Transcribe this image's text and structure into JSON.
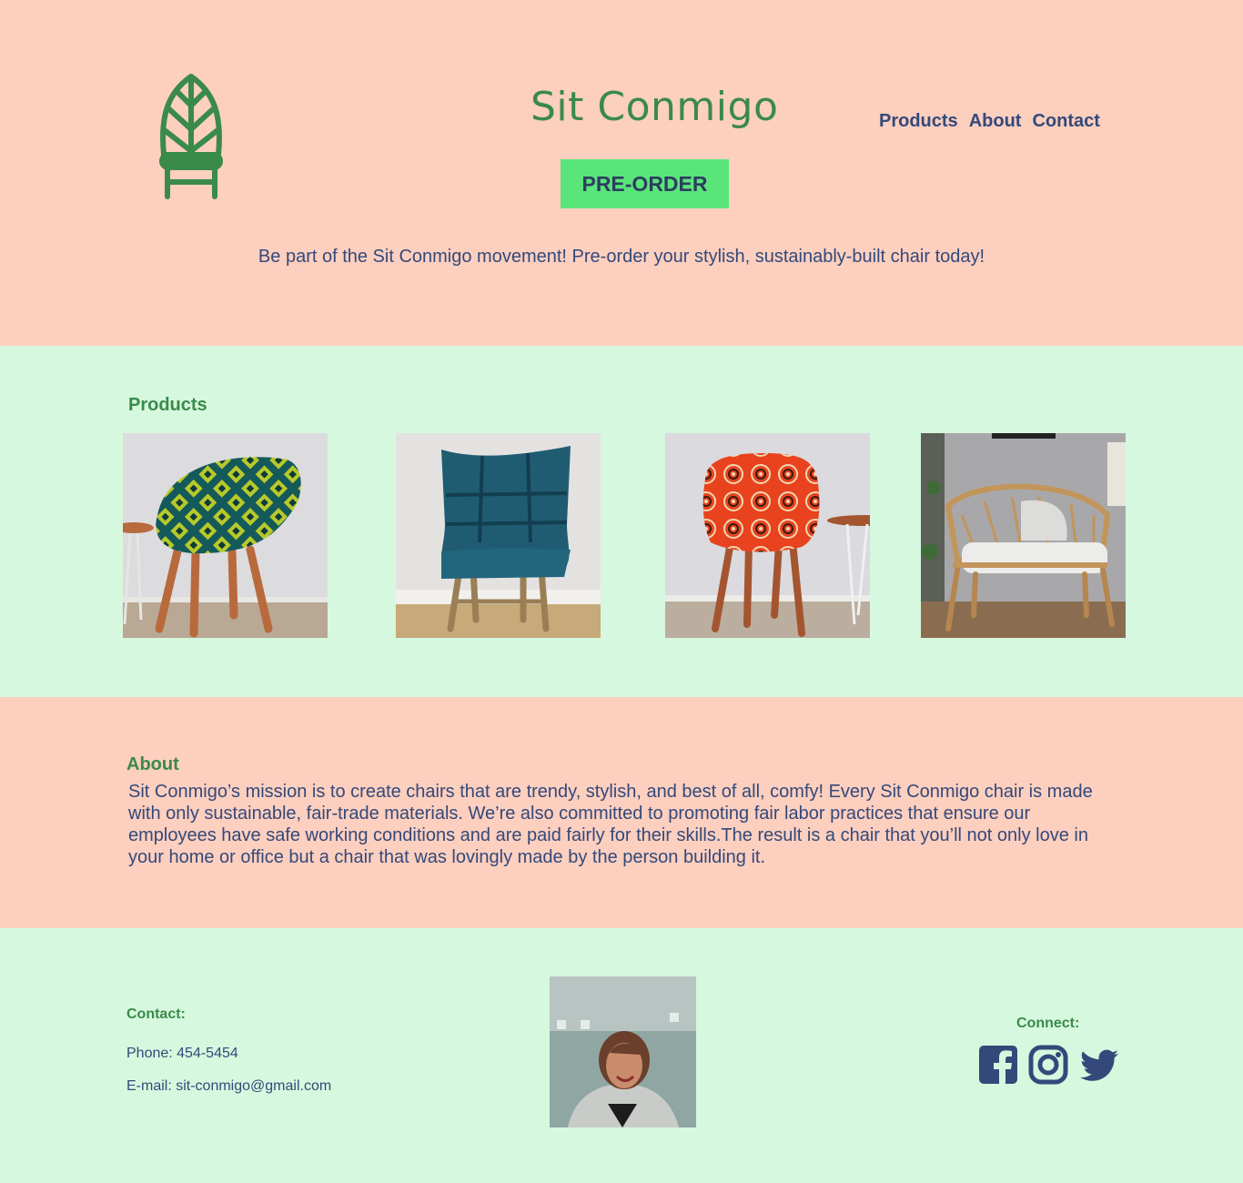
{
  "header": {
    "brand": "Sit Conmigo",
    "nav": [
      "Products",
      "About",
      "Contact"
    ],
    "preorder_label": "PRE-ORDER",
    "tagline": "Be part of the Sit Conmigo movement! Pre-order your stylish, sustainably-built chair today!"
  },
  "products": {
    "title": "Products"
  },
  "about": {
    "title": "About",
    "body": "Sit Conmigo’s mission is to create chairs that are trendy, stylish, and best of all, comfy! Every Sit Conmigo chair is made with only sustainable, fair-trade materials. We’re also committed to promoting fair labor practices that ensure our employees have safe working conditions and are paid fairly for their skills.The result is a chair that you’ll not only love in your home or office but a chair that was lovingly made by the person building it."
  },
  "footer": {
    "contact_title": "Contact:",
    "phone": "Phone: 454-5454",
    "email": "E-mail: sit-conmigo@gmail.com",
    "connect_title": "Connect:",
    "social_icons": [
      "facebook-icon",
      "instagram-icon",
      "twitter-icon"
    ]
  },
  "colors": {
    "peach": "#fccfbf",
    "mint": "#d6f8de",
    "green": "#3a8a4a",
    "button": "#5ae57b",
    "navy": "#34497a"
  }
}
